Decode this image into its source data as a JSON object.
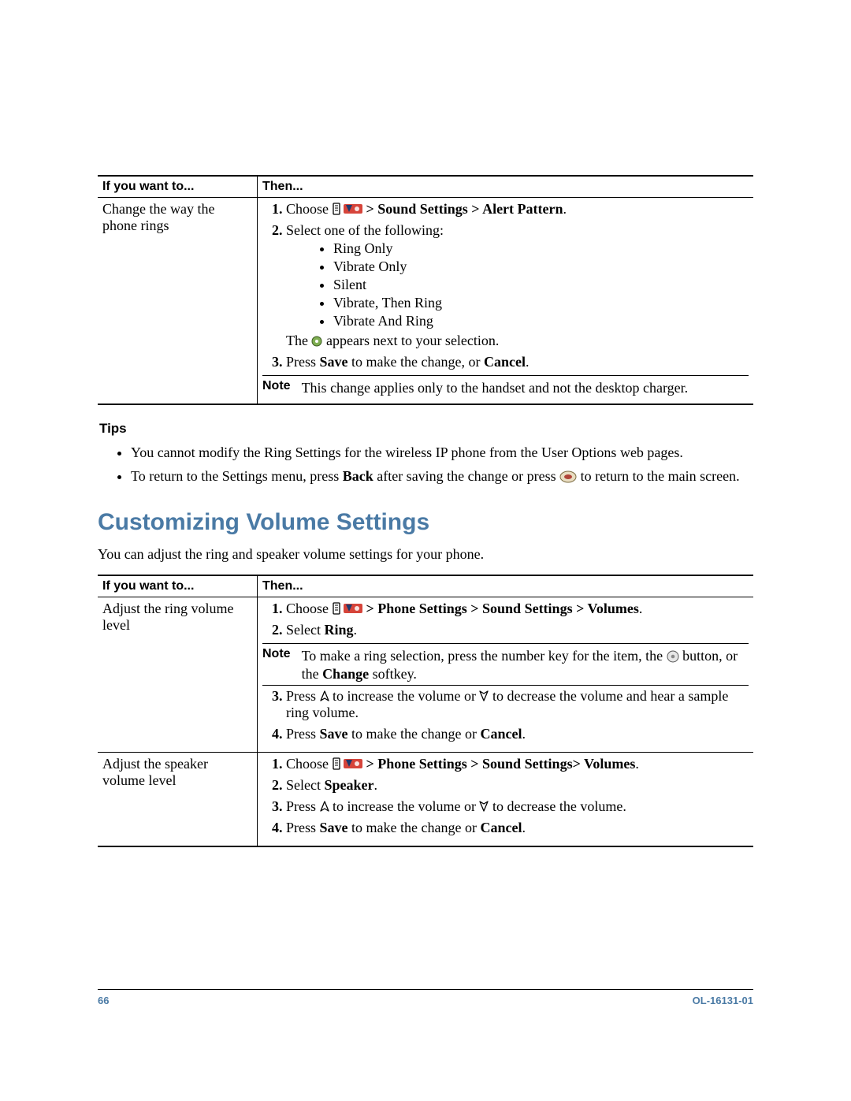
{
  "table1": {
    "header": {
      "col1": "If you want to...",
      "col2": "Then..."
    },
    "row1": {
      "want": "Change the way the phone rings",
      "step1_pre": "Choose ",
      "step1_path": " > Sound Settings > Alert Pattern",
      "step1_period": ".",
      "step2_text": "Select one of the following:",
      "bullets": [
        "Ring Only",
        "Vibrate Only",
        "Silent",
        "Vibrate, Then Ring",
        "Vibrate And Ring"
      ],
      "appears_pre": "The ",
      "appears_post": " appears next to your selection.",
      "step3_a": "Press ",
      "step3_b": "Save",
      "step3_c": " to make the change, or ",
      "step3_d": "Cancel",
      "step3_e": ".",
      "note_label": "Note",
      "note_body": "This change applies only to the handset and not the desktop charger."
    }
  },
  "tips": {
    "heading": "Tips",
    "item1": "You cannot modify the Ring Settings for the wireless IP phone from the User Options web pages.",
    "item2_a": "To return to the Settings menu, press ",
    "item2_b": "Back",
    "item2_c": " after saving the change or press ",
    "item2_d": " to return to the main screen."
  },
  "section": {
    "heading": "Customizing Volume Settings",
    "intro": "You can adjust the ring and speaker volume settings for your phone."
  },
  "table2": {
    "header": {
      "col1": "If you want to...",
      "col2": "Then..."
    },
    "rowA": {
      "want": "Adjust the ring volume level",
      "s1_pre": "Choose ",
      "s1_path": " > Phone Settings > Sound Settings > Volumes",
      "s1_period": ".",
      "s2_a": "Select ",
      "s2_b": "Ring",
      "s2_c": ".",
      "note_label": "Note",
      "note_a": "To make a ring selection, press the number key for the item, the ",
      "note_b": " button, or the ",
      "note_c": "Change",
      "note_d": " softkey.",
      "s3_a": "Press ",
      "s3_b": " to increase the volume or ",
      "s3_c": " to decrease the volume and hear a sample ring volume.",
      "s4_a": "Press ",
      "s4_b": "Save",
      "s4_c": " to make the change or ",
      "s4_d": "Cancel",
      "s4_e": "."
    },
    "rowB": {
      "want": "Adjust the speaker volume level",
      "s1_pre": "Choose ",
      "s1_path": " > Phone Settings > Sound Settings> Volumes",
      "s1_period": ".",
      "s2_a": "Select ",
      "s2_b": "Speaker",
      "s2_c": ".",
      "s3_a": "Press ",
      "s3_b": " to increase the volume or ",
      "s3_c": " to decrease the volume.",
      "s4_a": "Press ",
      "s4_b": "Save",
      "s4_c": " to make the change or ",
      "s4_d": "Cancel",
      "s4_e": "."
    }
  },
  "footer": {
    "page": "66",
    "doc": "OL-16131-01"
  }
}
